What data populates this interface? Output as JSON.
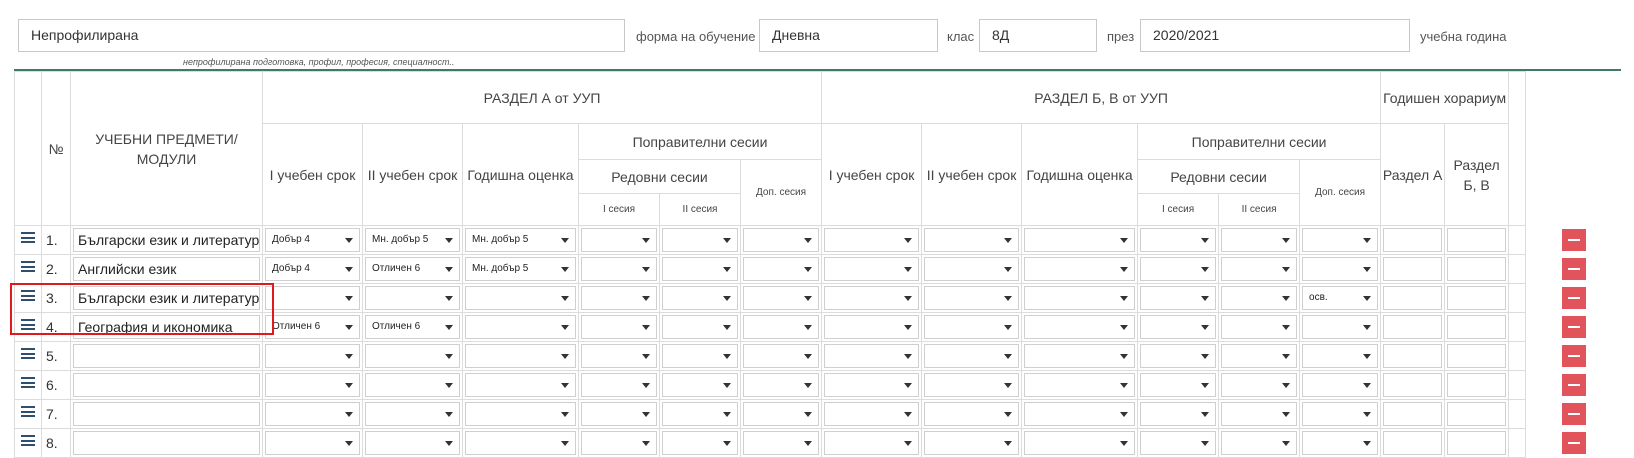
{
  "header": {
    "profile_value": "Непрофилирана",
    "profile_hint": "непрофилирана подготовка, профил, професия, специалност..",
    "form_label": "форма на обучение",
    "form_value": "Дневна",
    "class_label": "клас",
    "class_value": "8Д",
    "year_label": "през",
    "year_value": "2020/2021",
    "year_suffix": "учебна година"
  },
  "table": {
    "headers": {
      "num": "№",
      "subjects": "УЧЕБНИ ПРЕДМЕТИ/ МОДУЛИ",
      "section_a": "РАЗДЕЛ А от УУП",
      "section_bv": "РАЗДЕЛ Б, В от УУП",
      "annual_hours": "Годишен хорариум",
      "term1": "I учебен срок",
      "term2": "II учебен срок",
      "annual_grade": "Годишна оценка",
      "makeup": "Поправителни сесии",
      "regular": "Редовни сесии",
      "extra": "Доп. сесия",
      "session1": "I сесия",
      "session2": "II сесия",
      "hours_a": "Раздел А",
      "hours_bv": "Раздел Б, В"
    },
    "rows": [
      {
        "num": "1.",
        "subject": "Български език и литература",
        "a_t1": "Добър 4",
        "a_t2": "Мн. добър 5",
        "a_ann": "Мн. добър 5",
        "a_s1": "",
        "a_s2": "",
        "a_ex": "",
        "b_t1": "",
        "b_t2": "",
        "b_ann": "",
        "b_s1": "",
        "b_s2": "",
        "b_ex": ""
      },
      {
        "num": "2.",
        "subject": "Английски език",
        "a_t1": "Добър 4",
        "a_t2": "Отличен 6",
        "a_ann": "Мн. добър 5",
        "a_s1": "",
        "a_s2": "",
        "a_ex": "",
        "b_t1": "",
        "b_t2": "",
        "b_ann": "",
        "b_s1": "",
        "b_s2": "",
        "b_ex": ""
      },
      {
        "num": "3.",
        "subject": "Български език и литература",
        "a_t1": "",
        "a_t2": "",
        "a_ann": "",
        "a_s1": "",
        "a_s2": "",
        "a_ex": "",
        "b_t1": "",
        "b_t2": "",
        "b_ann": "",
        "b_s1": "",
        "b_s2": "",
        "b_ex": "осв."
      },
      {
        "num": "4.",
        "subject": "География и икономика",
        "a_t1": "Отличен 6",
        "a_t2": "Отличен 6",
        "a_ann": "",
        "a_s1": "",
        "a_s2": "",
        "a_ex": "",
        "b_t1": "",
        "b_t2": "",
        "b_ann": "",
        "b_s1": "",
        "b_s2": "",
        "b_ex": ""
      },
      {
        "num": "5.",
        "subject": "",
        "a_t1": "",
        "a_t2": "",
        "a_ann": "",
        "a_s1": "",
        "a_s2": "",
        "a_ex": "",
        "b_t1": "",
        "b_t2": "",
        "b_ann": "",
        "b_s1": "",
        "b_s2": "",
        "b_ex": ""
      },
      {
        "num": "6.",
        "subject": "",
        "a_t1": "",
        "a_t2": "",
        "a_ann": "",
        "a_s1": "",
        "a_s2": "",
        "a_ex": "",
        "b_t1": "",
        "b_t2": "",
        "b_ann": "",
        "b_s1": "",
        "b_s2": "",
        "b_ex": ""
      },
      {
        "num": "7.",
        "subject": "",
        "a_t1": "",
        "a_t2": "",
        "a_ann": "",
        "a_s1": "",
        "a_s2": "",
        "a_ex": "",
        "b_t1": "",
        "b_t2": "",
        "b_ann": "",
        "b_s1": "",
        "b_s2": "",
        "b_ex": ""
      },
      {
        "num": "8.",
        "subject": "",
        "a_t1": "",
        "a_t2": "",
        "a_ann": "",
        "a_s1": "",
        "a_s2": "",
        "a_ex": "",
        "b_t1": "",
        "b_t2": "",
        "b_ann": "",
        "b_s1": "",
        "b_s2": "",
        "b_ex": ""
      }
    ]
  },
  "colors": {
    "accent": "#3d7a6c",
    "delete": "#e2545b",
    "highlight": "#e0191d"
  }
}
